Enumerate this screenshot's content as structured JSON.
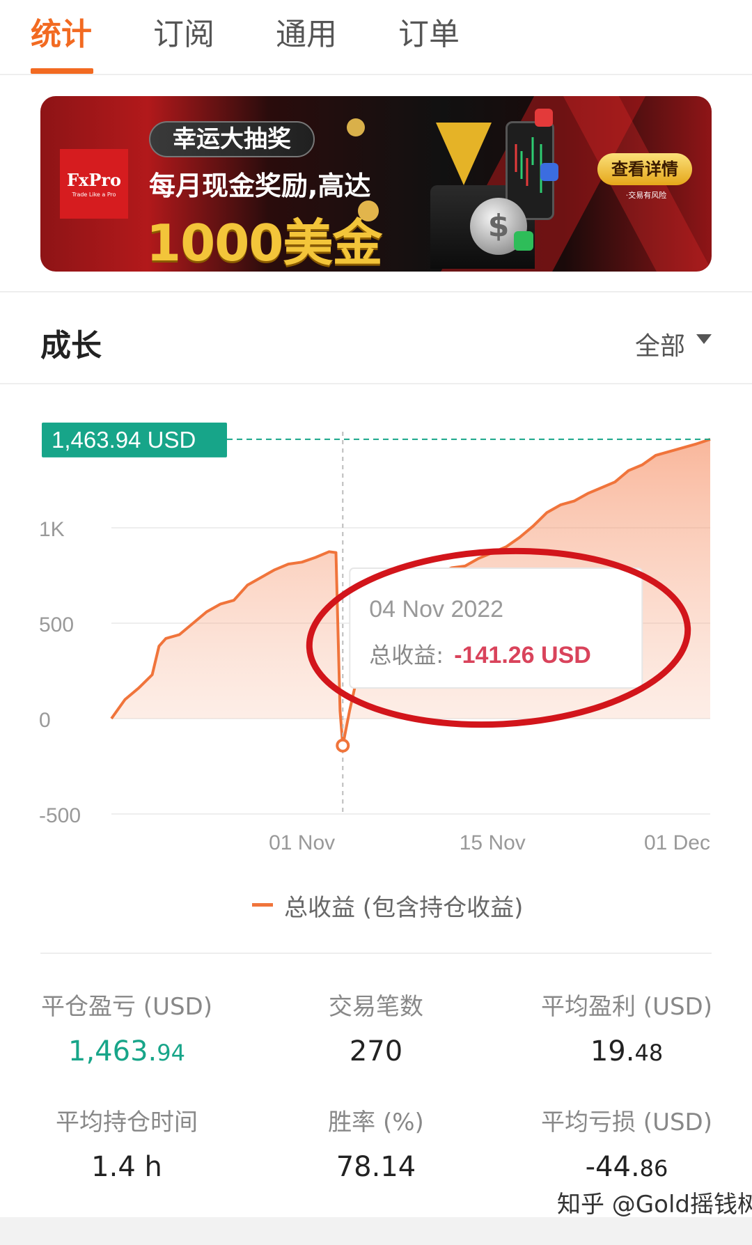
{
  "tabs": [
    {
      "label": "统计",
      "active": true
    },
    {
      "label": "订阅",
      "active": false
    },
    {
      "label": "通用",
      "active": false
    },
    {
      "label": "订单",
      "active": false
    }
  ],
  "banner": {
    "brand": "FxPro",
    "brand_tagline": "Trade Like a Pro",
    "pill": "幸运大抽奖",
    "line1": "每月现金奖励,高达",
    "amount": "1000美金",
    "cta": "查看详情",
    "risk_note": "·交易有风险",
    "colors": {
      "primary": "#b2191b",
      "gold": "#f3c53a"
    }
  },
  "growth": {
    "title": "成长",
    "range": "全部"
  },
  "chart_data": {
    "type": "area",
    "current_value_label": "1,463.94 USD",
    "y_ticks": [
      "1K",
      "500",
      "0",
      "-500"
    ],
    "x_ticks": [
      "01 Nov",
      "15 Nov",
      "01 Dec"
    ],
    "ylim": [
      -500,
      1500
    ],
    "x_unit": "days since 18 Oct 2022",
    "series": [
      {
        "name": "总收益 (包含持仓收益)",
        "color": "#f0743b",
        "x": [
          0,
          1,
          2,
          3,
          3.5,
          4,
          5,
          6,
          7,
          8,
          9,
          10,
          11,
          12,
          13,
          14,
          15,
          16,
          16.5,
          16.8,
          17,
          17.5,
          18,
          19,
          20,
          21,
          22,
          23,
          24,
          25,
          26,
          27,
          28,
          29,
          30,
          31,
          32,
          33,
          34,
          35,
          36,
          37,
          38,
          39,
          40,
          41,
          42,
          43,
          44
        ],
        "values": [
          0,
          100,
          160,
          230,
          380,
          420,
          440,
          500,
          560,
          600,
          620,
          700,
          740,
          780,
          810,
          820,
          845,
          875,
          870,
          40,
          -141.26,
          40,
          200,
          300,
          450,
          560,
          700,
          740,
          760,
          790,
          800,
          840,
          870,
          900,
          950,
          1010,
          1080,
          1120,
          1140,
          1180,
          1210,
          1240,
          1300,
          1330,
          1380,
          1400,
          1420,
          1440,
          1463.94
        ]
      }
    ],
    "tooltip": {
      "date": "04 Nov 2022",
      "label": "总收益:",
      "value": "-141.26 USD",
      "value_color": "#d9435b"
    },
    "grid": true,
    "legend_position": "bottom"
  },
  "stats": {
    "realized_pl": {
      "label": "平仓盈亏 (USD)",
      "int": "1,463.",
      "frac": "94"
    },
    "trade_count": {
      "label": "交易笔数",
      "int": "270",
      "frac": ""
    },
    "avg_profit": {
      "label": "平均盈利 (USD)",
      "int": "19.",
      "frac": "48"
    },
    "avg_hold": {
      "label": "平均持仓时间",
      "int": "1.4 h",
      "frac": ""
    },
    "win_rate": {
      "label": "胜率 (%)",
      "int": "78.14",
      "frac": ""
    },
    "avg_loss": {
      "label": "平均亏损 (USD)",
      "int": "-44.",
      "frac": "86"
    }
  },
  "watermark": "知乎 @Gold摇钱树"
}
